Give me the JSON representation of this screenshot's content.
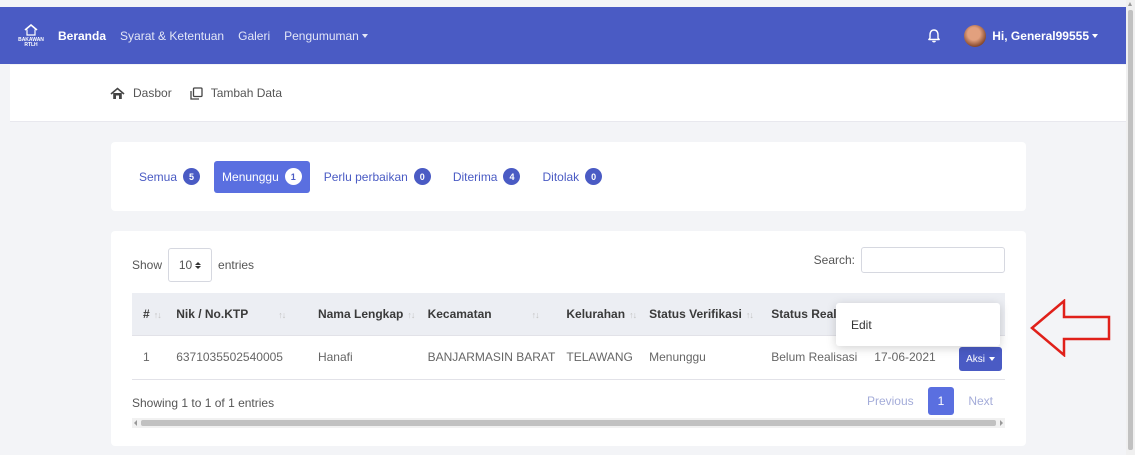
{
  "navbar": {
    "logo_text": "BAKAWAN\nRTLH",
    "links": [
      {
        "label": "Beranda",
        "active": true
      },
      {
        "label": "Syarat & Ketentuan",
        "active": false
      },
      {
        "label": "Galeri",
        "active": false
      },
      {
        "label": "Pengumuman",
        "active": false,
        "dropdown": true
      }
    ],
    "user_greeting": "Hi, General99555",
    "bell_icon": "bell-icon",
    "brand_color": "#4a5bc4"
  },
  "breadcrumb": [
    {
      "label": "Dasbor",
      "icon": "home-icon"
    },
    {
      "label": "Tambah Data",
      "icon": "copy-icon"
    }
  ],
  "tabs": [
    {
      "label": "Semua",
      "count": "5",
      "active": false
    },
    {
      "label": "Menunggu",
      "count": "1",
      "active": true
    },
    {
      "label": "Perlu perbaikan",
      "count": "0",
      "active": false
    },
    {
      "label": "Diterima",
      "count": "4",
      "active": false
    },
    {
      "label": "Ditolak",
      "count": "0",
      "active": false
    }
  ],
  "table": {
    "show_label": "Show",
    "entries_value": "10",
    "entries_label": "entries",
    "search_label": "Search:",
    "search_value": "",
    "columns": [
      "#",
      "Nik / No.KTP",
      "Nama Lengkap",
      "Kecamatan",
      "Kelurahan",
      "Status Verifikasi",
      "Status Realisasi"
    ],
    "rows": [
      {
        "no": "1",
        "nik": "6371035502540005",
        "nama": "Hanafi",
        "kecamatan": "BANJARMASIN BARAT",
        "kelurahan": "TELAWANG",
        "status_verifikasi": "Menunggu",
        "status_realisasi": "Belum Realisasi",
        "tanggal": "17-06-2021",
        "aksi_label": "Aksi"
      }
    ],
    "dropdown_items": [
      "Edit"
    ],
    "info": "Showing 1 to 1 of 1 entries",
    "pagination": {
      "previous": "Previous",
      "current": "1",
      "next": "Next"
    }
  },
  "annotation_color": "#e0201a"
}
